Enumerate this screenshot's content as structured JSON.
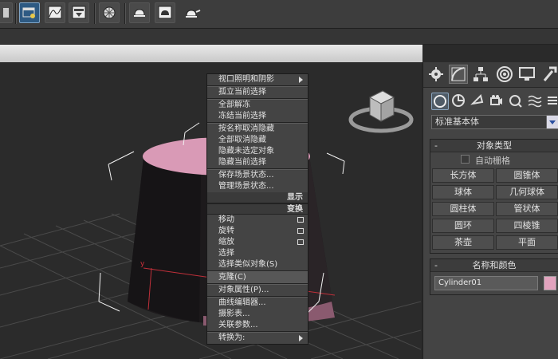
{
  "colors": {
    "object_color": "#e2a3be",
    "cylinder_top": "#d99ab6",
    "cylinder_side": "#1d1a1c",
    "menu_bg": "#444444",
    "panel_bg": "#444444"
  },
  "toolbar": {
    "buttons": [
      {
        "icon": "schematic-icon",
        "active": false
      },
      {
        "icon": "layer-manager-icon",
        "active": true
      },
      {
        "icon": "curve-editor-icon",
        "active": false
      },
      {
        "icon": "dope-sheet-icon",
        "active": false
      },
      {
        "icon": "material-editor-icon",
        "active": false
      },
      {
        "icon": "render-setup-icon",
        "active": false
      },
      {
        "icon": "rendered-frame-icon",
        "active": false
      },
      {
        "icon": "render-teapot-icon",
        "active": false
      }
    ]
  },
  "context_menu": {
    "group1": [
      {
        "label": "视口照明和阴影",
        "submenu": true
      },
      {
        "label": "孤立当前选择"
      },
      {
        "label": "全部解冻"
      },
      {
        "label": "冻结当前选择"
      },
      {
        "label": "按名称取消隐藏"
      },
      {
        "label": "全部取消隐藏"
      },
      {
        "label": "隐藏未选定对象"
      },
      {
        "label": "隐藏当前选择"
      },
      {
        "label": "保存场景状态..."
      },
      {
        "label": "管理场景状态..."
      }
    ],
    "header_display": "显示",
    "header_transform": "变换",
    "group2": [
      {
        "label": "移动",
        "box": true
      },
      {
        "label": "旋转",
        "box": true
      },
      {
        "label": "缩放",
        "box": true
      },
      {
        "label": "选择"
      },
      {
        "label": "选择类似对象(S)"
      }
    ],
    "group3": [
      {
        "label": "克隆(C)"
      },
      {
        "label": "对象属性(P)..."
      },
      {
        "label": "曲线编辑器..."
      },
      {
        "label": "摄影表..."
      },
      {
        "label": "关联参数..."
      },
      {
        "label": "转换为:",
        "submenu": true
      }
    ]
  },
  "panel": {
    "tabs": [
      "create-tab-icon",
      "modify-tab-icon",
      "hierarchy-tab-icon",
      "motion-tab-icon",
      "display-tab-icon",
      "utilities-tab-icon"
    ],
    "categories": [
      "geometry-icon",
      "shapes-icon",
      "lights-icon",
      "cameras-icon",
      "helpers-icon",
      "spacewarps-icon",
      "systems-icon"
    ],
    "dropdown_value": "标准基本体",
    "object_type": {
      "title": "对象类型",
      "autogrid_label": "自动栅格",
      "buttons": [
        "长方体",
        "圆锥体",
        "球体",
        "几何球体",
        "圆柱体",
        "管状体",
        "圆环",
        "四棱锥",
        "茶壶",
        "平面"
      ]
    },
    "name_color": {
      "title": "名称和颜色",
      "name_value": "Cylinder01"
    }
  },
  "viewport": {
    "axis_label": "y"
  }
}
